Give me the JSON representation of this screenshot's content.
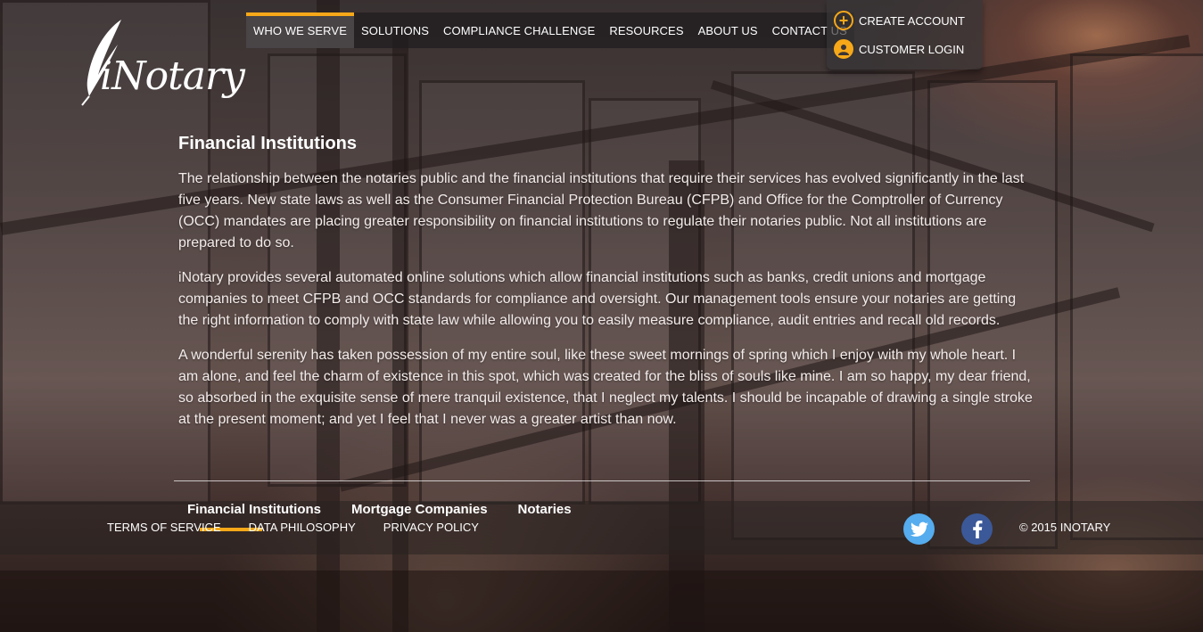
{
  "brand": {
    "logo_text": "iNotary"
  },
  "nav": {
    "items": [
      {
        "label": "WHO WE SERVE",
        "active": true
      },
      {
        "label": "SOLUTIONS"
      },
      {
        "label": "COMPLIANCE CHALLENGE"
      },
      {
        "label": "RESOURCES"
      },
      {
        "label": "ABOUT US"
      },
      {
        "label": "CONTACT US"
      }
    ]
  },
  "account": {
    "create": "CREATE ACCOUNT",
    "login": "CUSTOMER LOGIN"
  },
  "main": {
    "title": "Financial Institutions",
    "paragraphs": [
      "The relationship between the notaries public and the financial institutions that require their services has evolved significantly in the last five years. New state laws as well as the Consumer Financial Protection Bureau (CFPB) and Office for the Comptroller of Currency (OCC) mandates are placing greater responsibility on financial institutions to regulate their notaries public. Not all institutions are prepared to do so.",
      "iNotary provides several automated online solutions which allow financial institutions such as banks, credit unions and mortgage companies to meet CFPB and OCC standards for compliance and oversight. Our management tools ensure your notaries are getting the right information to comply with state law while allowing you to easily measure compliance, audit entries and recall old records.",
      "A wonderful serenity has taken possession of my entire soul, like these sweet mornings of spring which I enjoy with my whole heart. I am alone, and feel the charm of existence in this spot, which was created for the bliss of souls like mine. I am so happy, my dear friend, so absorbed in the exquisite sense of mere tranquil existence, that I neglect my talents. I should be incapable of drawing a single stroke at the present moment; and yet I feel that I never was a greater artist than now."
    ]
  },
  "subnav": {
    "items": [
      "Financial Institutions",
      "Mortgage Companies",
      "Notaries"
    ]
  },
  "footer": {
    "links": [
      "TERMS OF SERVICE",
      "DATA PHILOSOPHY",
      "PRIVACY POLICY"
    ],
    "copyright": "© 2015 INOTARY"
  },
  "colors": {
    "accent": "#f6a819",
    "twitter": "#55acee",
    "facebook": "#3b5998"
  }
}
